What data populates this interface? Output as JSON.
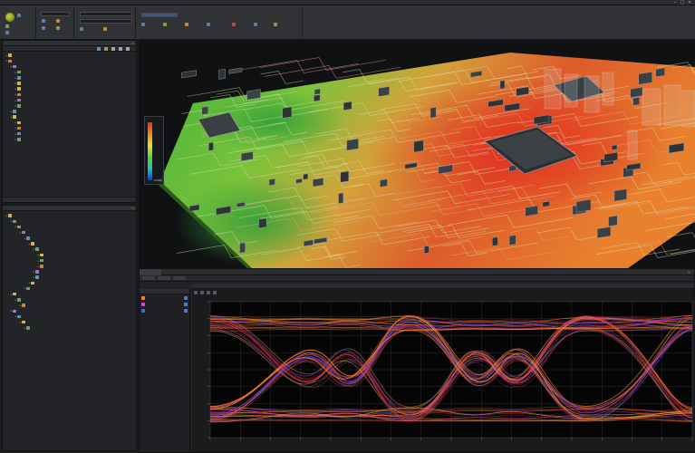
{
  "window": {
    "title": ""
  },
  "colors": {
    "accent": "#4a7ad0",
    "heat_high": "#e23020",
    "heat_low": "#1040e0",
    "board_green": "#4fa83a",
    "eye_hot": "#ff7a1e",
    "eye_cool": "#3a48c8"
  },
  "view3d": {
    "legend": {
      "title": "",
      "ticks": [
        "",
        "",
        "",
        "",
        "",
        "",
        "0.000"
      ]
    }
  },
  "icons": [
    "app-logo-icon",
    "close-icon",
    "minimize-icon",
    "maximize-icon",
    "expand-arrow-icon",
    "checkbox-icon"
  ]
}
